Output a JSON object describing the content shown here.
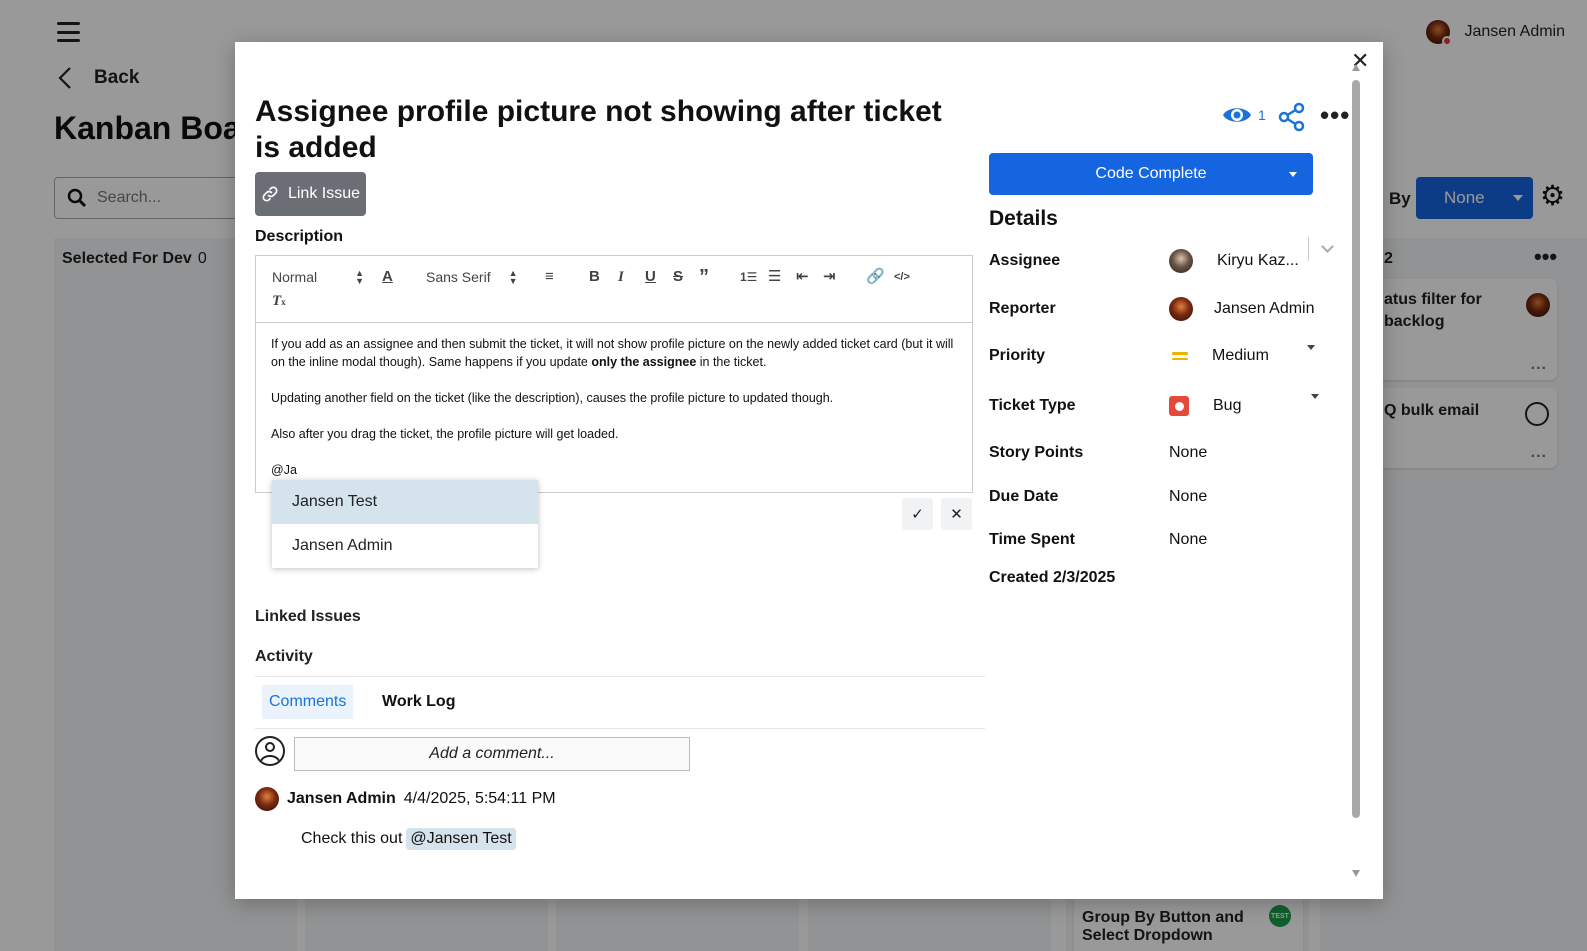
{
  "background": {
    "user_name": "Jansen Admin",
    "back_label": "Back",
    "board_title": "Kanban Boar",
    "search_placeholder": "Search...",
    "column_name": "Selected For Dev",
    "column_count": "0",
    "right_column_count": "2",
    "group_label": "By",
    "group_value": "None",
    "cards": [
      {
        "line1": "atus filter for",
        "line2": "backlog"
      },
      {
        "line1": "Q bulk email",
        "line2": ""
      },
      {
        "line1": "Group By Button and",
        "line2": "Select Dropdown"
      }
    ],
    "test_badge": "TEST",
    "ellipsis": "..."
  },
  "modal": {
    "title": "Assignee profile picture not showing after ticket is added",
    "link_issue_label": "Link Issue",
    "description_label": "Description",
    "toolbar": {
      "heading_select": "Normal",
      "font_select": "Sans Serif"
    },
    "description_paragraphs": [
      {
        "before": "If you add as an assignee and then submit the ticket, it will not show profile picture on the newly added ticket card (but it will on the inline modal though). Same happens if you update ",
        "bold": "only the assignee",
        "after": " in the ticket."
      },
      {
        "before": "Updating another field on the ticket (like the description), causes the profile picture to updated though.",
        "bold": "",
        "after": ""
      },
      {
        "before": "Also after you drag the ticket, the profile picture will get loaded.",
        "bold": "",
        "after": ""
      },
      {
        "before": "@Ja",
        "bold": "",
        "after": ""
      }
    ],
    "mention_options": [
      "Jansen Test",
      "Jansen Admin"
    ],
    "linked_issues_label": "Linked Issues",
    "activity_label": "Activity",
    "tabs": [
      "Comments",
      "Work Log"
    ],
    "comment_placeholder": "Add a comment...",
    "comment": {
      "author": "Jansen Admin",
      "timestamp": "4/4/2025, 5:54:11 PM",
      "text": "Check this out",
      "mention": "@Jansen Test"
    },
    "watchers_count": "1",
    "status_label": "Code Complete",
    "details_title": "Details",
    "details": {
      "assignee_label": "Assignee",
      "assignee_value": "Kiryu Kaz...",
      "reporter_label": "Reporter",
      "reporter_value": "Jansen Admin",
      "priority_label": "Priority",
      "priority_value": "Medium",
      "ticket_type_label": "Ticket Type",
      "ticket_type_value": "Bug",
      "story_points_label": "Story Points",
      "story_points_value": "None",
      "due_date_label": "Due Date",
      "due_date_value": "None",
      "time_spent_label": "Time Spent",
      "time_spent_value": "None",
      "created": "Created 2/3/2025"
    },
    "colors": {
      "primary": "#1565e0",
      "link_issue_bg": "#6b6f75",
      "mention_highlight": "#d5e3ec",
      "priority_medium": "#f0b400",
      "bug": "#e5493a"
    }
  }
}
